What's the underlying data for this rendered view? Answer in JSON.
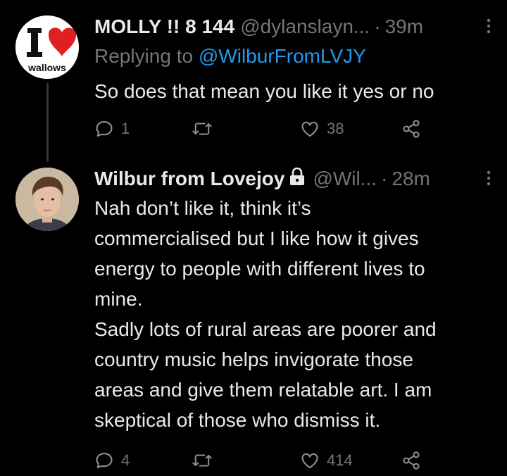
{
  "tweets": [
    {
      "display_name": "MOLLY !! 8 144",
      "handle": "@dylanslayn...",
      "separator": "·",
      "time": "39m",
      "replying_prefix": "Replying to",
      "replying_to": "@WilburFromLVJY",
      "text_lines": [
        "So does that mean you like it yes or no"
      ],
      "avatar_logo_text": "wallows",
      "reply_count": "1",
      "retweet_count": "",
      "like_count": "38"
    },
    {
      "display_name": "Wilbur from Lovejoy",
      "handle": "@Wil...",
      "separator": "·",
      "time": "28m",
      "locked": true,
      "text_lines": [
        "Nah don’t like it, think it’s",
        "commercialised but I like how it gives",
        "energy to people with different lives to",
        "mine.",
        "Sadly lots of rural areas are poorer and",
        "country music helps invigorate those",
        "areas and give them relatable art. I am",
        "skeptical of those who dismiss it."
      ],
      "reply_count": "4",
      "retweet_count": "",
      "like_count": "414"
    }
  ],
  "colors": {
    "background": "#000000",
    "text": "#e7e9ea",
    "muted": "#71767b",
    "link": "#1d9bf0",
    "thread_line": "#333639",
    "heart_logo": "#e02020"
  },
  "icons": [
    "reply-icon",
    "retweet-icon",
    "like-icon",
    "share-icon",
    "more-icon",
    "lock-icon"
  ]
}
